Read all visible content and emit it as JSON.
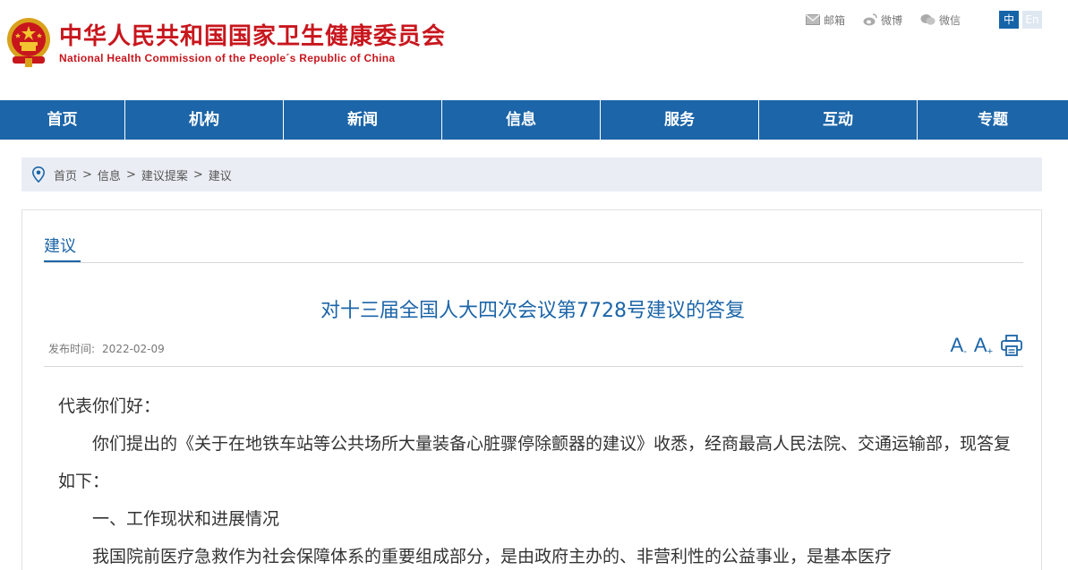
{
  "header": {
    "title_cn": "中华人民共和国国家卫生健康委员会",
    "title_en": "National Health Commission of the People´s Republic of China",
    "links": [
      {
        "icon": "mail-icon",
        "label": "邮箱"
      },
      {
        "icon": "weibo-icon",
        "label": "微博"
      },
      {
        "icon": "wechat-icon",
        "label": "微信"
      }
    ],
    "lang_cn": "中",
    "lang_en": "En"
  },
  "nav": {
    "items": [
      {
        "label": "首页"
      },
      {
        "label": "机构"
      },
      {
        "label": "新闻"
      },
      {
        "label": "信息"
      },
      {
        "label": "服务"
      },
      {
        "label": "互动"
      },
      {
        "label": "专题"
      }
    ]
  },
  "breadcrumb": {
    "items": [
      "首页",
      "信息",
      "建议提案",
      "建议"
    ],
    "separator": ">"
  },
  "section": {
    "title": "建议"
  },
  "article": {
    "title": "对十三届全国人大四次会议第7728号建议的答复",
    "date_label": "发布时间:",
    "date": "2022-02-09",
    "font_decrease": "A",
    "font_decrease_sup": "-",
    "font_increase": "A",
    "font_increase_sup": "+",
    "paragraphs": [
      "代表你们好：",
      "你们提出的《关于在地铁车站等公共场所大量装备心脏骤停除颤器的建议》收悉，经商最高人民法院、交通运输部，现答复如下：",
      "一、工作现状和进展情况",
      "我国院前医疗急救作为社会保障体系的重要组成部分，是由政府主办的、非营利性的公益事业，是基本医疗"
    ]
  },
  "colors": {
    "brand_red": "#c8161d",
    "nav_blue": "#1c65a8",
    "breadcrumb_bg": "#eaeef4"
  }
}
